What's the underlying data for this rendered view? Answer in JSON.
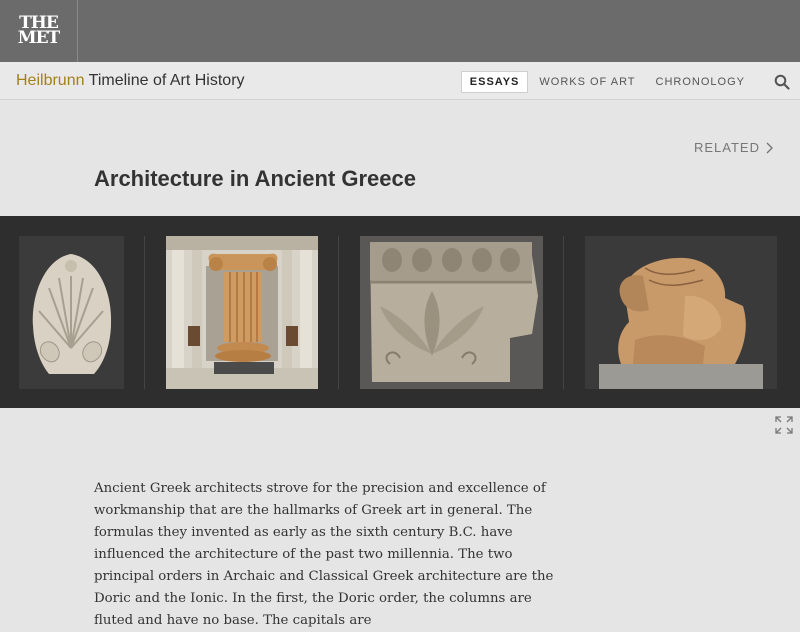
{
  "header": {
    "logo_line1": "THE",
    "logo_line2": "MET"
  },
  "navbar": {
    "brand_highlight": "Heilbrunn",
    "brand_rest": " Timeline of Art History",
    "items": [
      {
        "label": "ESSAYS",
        "active": true
      },
      {
        "label": "WORKS OF ART",
        "active": false
      },
      {
        "label": "CHRONOLOGY",
        "active": false
      }
    ]
  },
  "related_label": "RELATED",
  "title": "Architecture in Ancient Greece",
  "gallery": {
    "images": [
      {
        "name": "palmette-antefix"
      },
      {
        "name": "ionic-column-gallery"
      },
      {
        "name": "relief-block"
      },
      {
        "name": "lion-sculpture"
      }
    ]
  },
  "body": {
    "paragraph": "Ancient Greek architects strove for the precision and excellence of workmanship that are the hallmarks of Greek art in general. The formulas they invented as early as the sixth century B.C. have influenced the architecture of the past two millennia. The two principal orders in Archaic and Classical Greek architecture are the Doric and the Ionic. In the first, the Doric order, the columns are fluted and have no base. The capitals are"
  },
  "colors": {
    "topbar": "#6b6b6b",
    "brand_accent": "#a28214",
    "gallery_bg": "#2e2e2e"
  }
}
